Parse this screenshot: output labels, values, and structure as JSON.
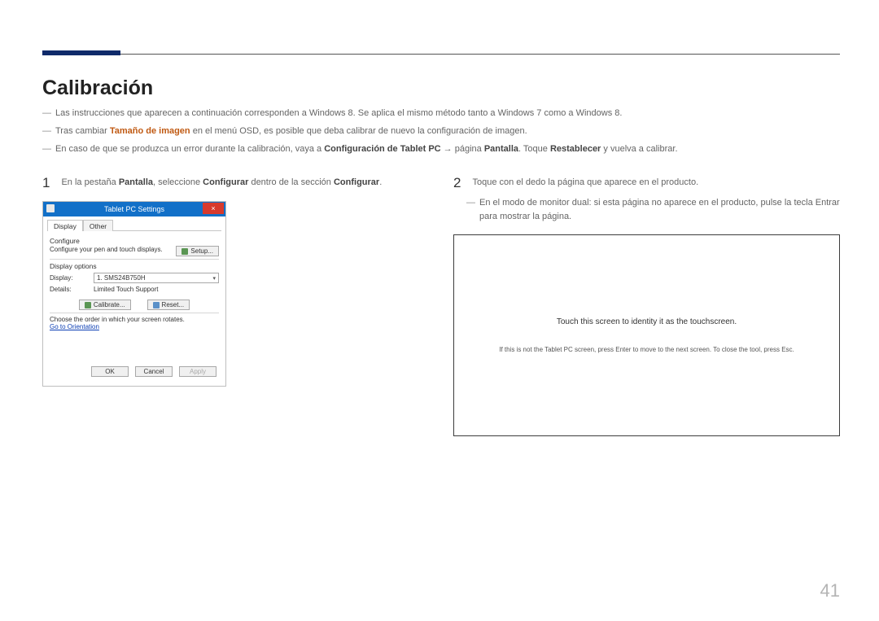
{
  "title": "Calibración",
  "notes": {
    "n1": "Las instrucciones que aparecen a continuación corresponden a Windows 8. Se aplica el mismo método tanto a Windows 7 como a Windows 8.",
    "n2_a": "Tras cambiar ",
    "n2_b": "Tamaño de imagen",
    "n2_c": " en el menú OSD, es posible que deba calibrar de nuevo la configuración de imagen.",
    "n3_a": "En caso de que se produzca un error durante la calibración, vaya a ",
    "n3_b": "Configuración de Tablet PC",
    "n3_c": " → página ",
    "n3_d": "Pantalla",
    "n3_e": ". Toque ",
    "n3_f": "Restablecer",
    "n3_g": " y vuelva a calibrar."
  },
  "step1": {
    "num": "1",
    "a": "En la pestaña ",
    "b": "Pantalla",
    "c": ", seleccione ",
    "d": "Configurar",
    "e": " dentro de la sección ",
    "f": "Configurar",
    "g": "."
  },
  "step2": {
    "num": "2",
    "text": "Toque con el dedo la página que aparece en el producto.",
    "sub": "En el modo de monitor dual: si esta página no aparece en el producto, pulse la tecla Entrar para mostrar la página."
  },
  "win": {
    "title": "Tablet PC Settings",
    "close": "×",
    "tab_display": "Display",
    "tab_other": "Other",
    "configure": "Configure",
    "configure_text": "Configure your pen and touch displays.",
    "setup_btn": "Setup...",
    "display_options": "Display options",
    "display_lbl": "Display:",
    "display_val": "1. SMS24B750H",
    "details_lbl": "Details:",
    "details_val": "Limited Touch Support",
    "calibrate_btn": "Calibrate...",
    "reset_btn": "Reset...",
    "choose_text": "Choose the order in which your screen rotates.",
    "orientation_link": "Go to Orientation",
    "ok": "OK",
    "cancel": "Cancel",
    "apply": "Apply"
  },
  "touch": {
    "main": "Touch this screen to identity it as the touchscreen.",
    "sub": "If this is not the Tablet PC screen, press Enter to move to the next screen. To close the tool, press Esc."
  },
  "page_number": "41"
}
